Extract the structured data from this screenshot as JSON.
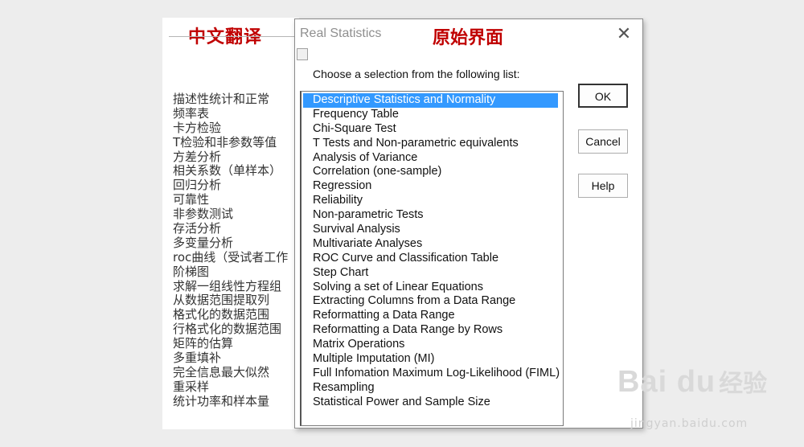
{
  "left_panel": {
    "title": "中文翻译",
    "items": [
      "描述性统计和正常",
      "频率表",
      "卡方检验",
      "T检验和非参数等值",
      "方差分析",
      "相关系数（单样本）",
      "回归分析",
      "可靠性",
      "非参数测试",
      "存活分析",
      "多变量分析",
      "roc曲线（受试者工作",
      "阶梯图",
      "求解一组线性方程组",
      "从数据范围提取列",
      "格式化的数据范围",
      "行格式化的数据范围",
      "矩阵的估算",
      "多重填补",
      "完全信息最大似然",
      "重采样",
      "统计功率和样本量"
    ]
  },
  "dialog": {
    "title": "Real Statistics",
    "title_annotation": "原始界面",
    "close_glyph": "✕",
    "prompt": "Choose a selection from the following list:",
    "selected_index": 0,
    "options": [
      "Descriptive Statistics and Normality",
      "Frequency Table",
      "Chi-Square Test",
      "T Tests and Non-parametric equivalents",
      "Analysis of Variance",
      "Correlation (one-sample)",
      "Regression",
      "Reliability",
      "Non-parametric Tests",
      "Survival Analysis",
      "Multivariate Analyses",
      "ROC Curve and Classification Table",
      "Step Chart",
      "Solving a set of Linear Equations",
      "Extracting Columns from a Data Range",
      "Reformatting a Data Range",
      "Reformatting a Data Range by Rows",
      "Matrix Operations",
      "Multiple Imputation (MI)",
      "Full Infomation Maximum Log-Likelihood (FIML)",
      "Resampling",
      "Statistical Power and Sample Size"
    ],
    "buttons": {
      "ok": "OK",
      "cancel": "Cancel",
      "help": "Help"
    },
    "selection_color": "#3399ff"
  },
  "watermark": {
    "logo": "Bai du",
    "logo_cn": "经验",
    "url": "jingyan.baidu.com"
  }
}
